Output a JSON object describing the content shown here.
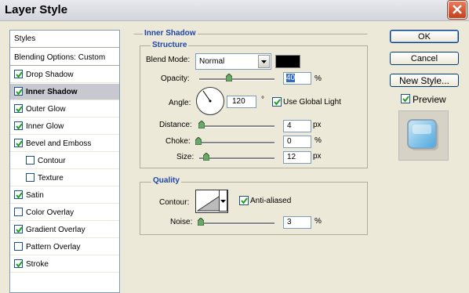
{
  "window": {
    "title": "Layer Style"
  },
  "styles_list": {
    "header": "Styles",
    "blending_options": "Blending Options: Custom",
    "items": [
      {
        "label": "Drop Shadow",
        "checked": true,
        "selected": false
      },
      {
        "label": "Inner Shadow",
        "checked": true,
        "selected": true
      },
      {
        "label": "Outer Glow",
        "checked": true,
        "selected": false
      },
      {
        "label": "Inner Glow",
        "checked": true,
        "selected": false
      },
      {
        "label": "Bevel and Emboss",
        "checked": true,
        "selected": false
      },
      {
        "label": "Contour",
        "checked": false,
        "selected": false,
        "indented": true
      },
      {
        "label": "Texture",
        "checked": false,
        "selected": false,
        "indented": true
      },
      {
        "label": "Satin",
        "checked": true,
        "selected": false
      },
      {
        "label": "Color Overlay",
        "checked": false,
        "selected": false
      },
      {
        "label": "Gradient Overlay",
        "checked": true,
        "selected": false
      },
      {
        "label": "Pattern Overlay",
        "checked": false,
        "selected": false
      },
      {
        "label": "Stroke",
        "checked": true,
        "selected": false
      }
    ]
  },
  "inner_shadow": {
    "section_title": "Inner Shadow",
    "structure_title": "Structure",
    "blend_mode_label": "Blend Mode:",
    "blend_mode_value": "Normal",
    "shadow_color": "#000000",
    "opacity_label": "Opacity:",
    "opacity_value": "40",
    "opacity_unit": "%",
    "angle_label": "Angle:",
    "angle_value": "120",
    "angle_unit": "°",
    "use_global_light_label": "Use Global Light",
    "use_global_light": true,
    "distance_label": "Distance:",
    "distance_value": "4",
    "distance_unit": "px",
    "choke_label": "Choke:",
    "choke_value": "0",
    "choke_unit": "%",
    "size_label": "Size:",
    "size_value": "12",
    "size_unit": "px"
  },
  "quality": {
    "title": "Quality",
    "contour_label": "Contour:",
    "anti_aliased_label": "Anti-aliased",
    "anti_aliased": true,
    "noise_label": "Noise:",
    "noise_value": "3",
    "noise_unit": "%"
  },
  "buttons": {
    "ok": "OK",
    "cancel": "Cancel",
    "new_style": "New Style...",
    "preview_label": "Preview",
    "preview_checked": true
  },
  "icons": [
    "close-icon",
    "checkmark-icon",
    "dropdown-arrow-icon",
    "slider-thumb-icon"
  ]
}
